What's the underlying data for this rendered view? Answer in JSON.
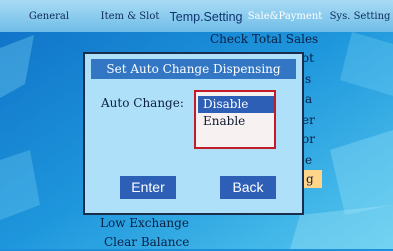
{
  "tabs": [
    {
      "label": "General"
    },
    {
      "label": "Item & Slot"
    },
    {
      "label": "Temp.Setting"
    },
    {
      "label": "Sale&Payment"
    },
    {
      "label": "Sys. Setting"
    }
  ],
  "menu": {
    "items": [
      {
        "label": "Check Total Sales",
        "visible": "Check Total Sales"
      },
      {
        "label": "",
        "visible": "lot"
      },
      {
        "label": "",
        "visible": "s"
      },
      {
        "label": "",
        "visible": "a"
      },
      {
        "label": "",
        "visible": "er"
      },
      {
        "label": "",
        "visible": "or"
      },
      {
        "label": "",
        "visible": "e"
      },
      {
        "label": "",
        "visible": "g"
      },
      {
        "label": "Low Exchange",
        "visible": "Low Exchange"
      },
      {
        "label": "Clear Balance",
        "visible": "Clear Balance"
      }
    ]
  },
  "dialog": {
    "title": "Set Auto Change Dispensing",
    "field_label": "Auto Change:",
    "options": [
      "Disable",
      "Enable"
    ],
    "selected_option": "Disable",
    "enter_label": "Enter",
    "back_label": "Back"
  },
  "colors": {
    "tabbar": "#7ec8f0",
    "dialog_background": "#aee0fa",
    "title_bar": "#3276c4",
    "button": "#2c5fb5",
    "listbox_border": "#c01c2a",
    "highlight": "#ffd58a"
  }
}
